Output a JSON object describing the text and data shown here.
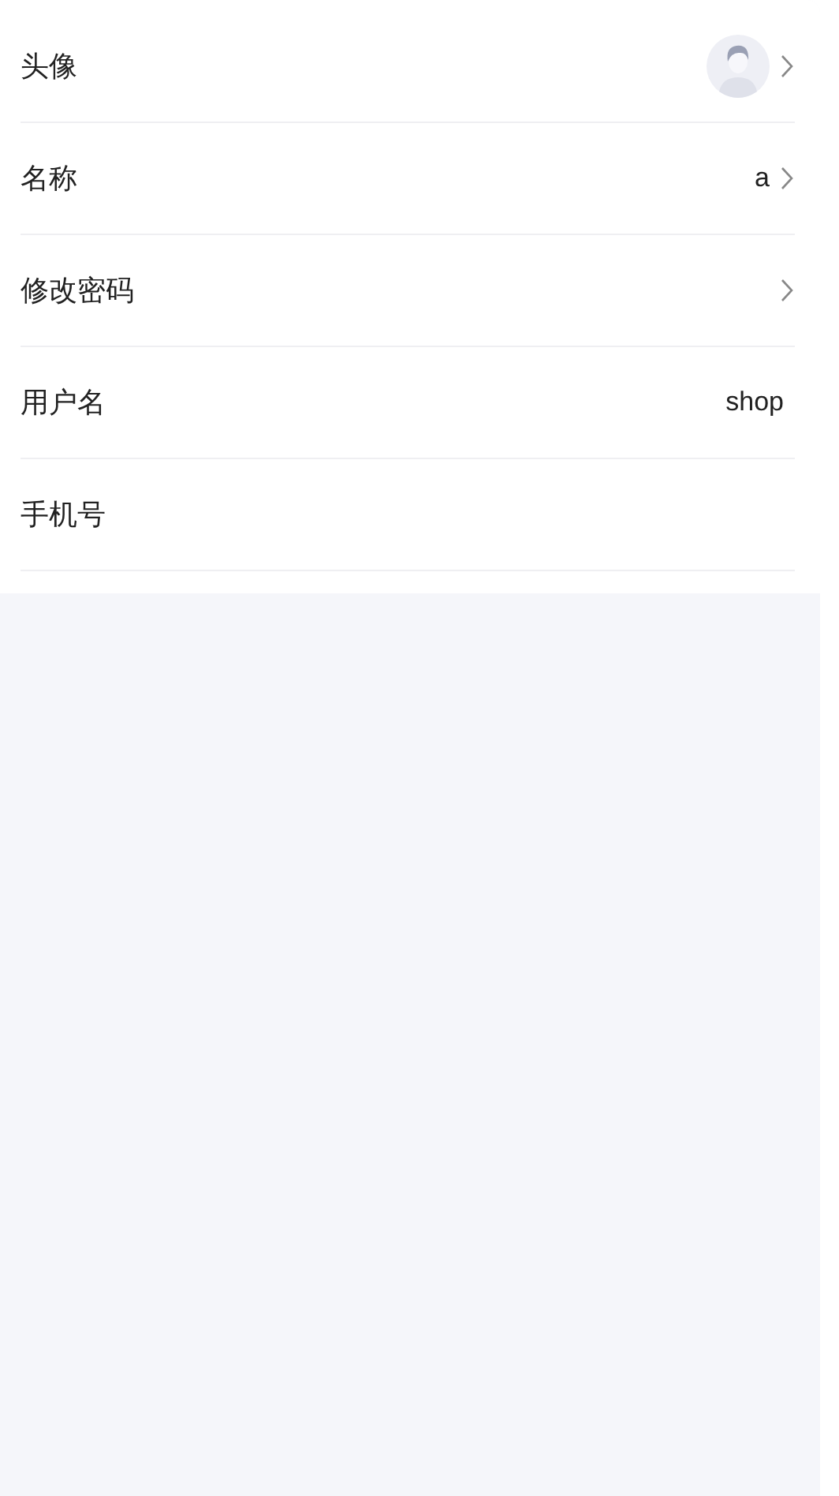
{
  "rows": [
    {
      "kind": "avatar",
      "label": "头像",
      "arrow": true
    },
    {
      "kind": "text",
      "label": "名称",
      "value": "a",
      "arrow": true
    },
    {
      "kind": "text",
      "label": "修改密码",
      "arrow": true
    },
    {
      "kind": "text",
      "label": "用户名",
      "value": "shop",
      "arrow": false
    },
    {
      "kind": "text",
      "label": "手机号",
      "arrow": false
    }
  ]
}
